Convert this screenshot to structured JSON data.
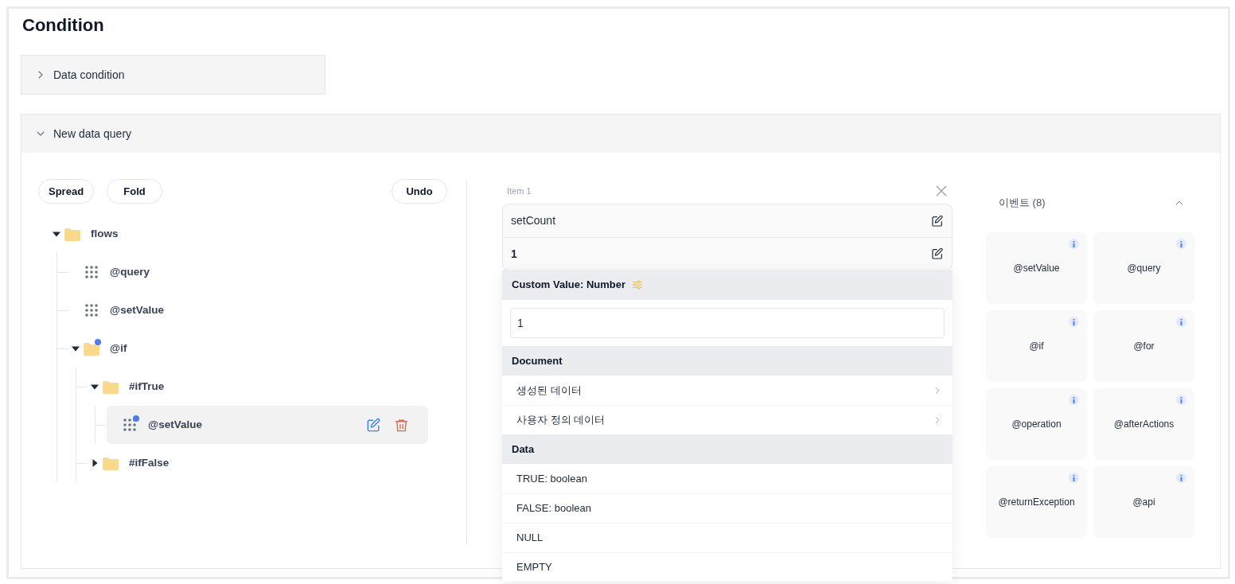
{
  "title": "Condition",
  "accordions": [
    {
      "label": "Data condition",
      "expanded": false
    },
    {
      "label": "New data query",
      "expanded": true
    }
  ],
  "toolbar": {
    "left_buttons": [
      "Spread",
      "Fold"
    ],
    "right_button": "Undo"
  },
  "tree": [
    {
      "label": "flows",
      "kind": "folder",
      "expanded": true,
      "modified": false,
      "selected": false,
      "children": [
        {
          "label": "@query",
          "kind": "node",
          "modified": false,
          "selected": false
        },
        {
          "label": "@setValue",
          "kind": "node",
          "modified": false,
          "selected": false
        },
        {
          "label": "@if",
          "kind": "folder",
          "expanded": true,
          "modified": true,
          "selected": false,
          "children": [
            {
              "label": "#ifTrue",
              "kind": "folder",
              "expanded": true,
              "modified": false,
              "selected": false,
              "children": [
                {
                  "label": "@setValue",
                  "kind": "node",
                  "modified": true,
                  "selected": true
                }
              ]
            },
            {
              "label": "#ifFalse",
              "kind": "folder",
              "expanded": false,
              "modified": false,
              "selected": false
            }
          ]
        }
      ]
    }
  ],
  "item_panel": {
    "label": "Item 1",
    "fields": [
      {
        "value": "setCount",
        "bold": false
      },
      {
        "value": "1",
        "bold": true
      }
    ],
    "dropdown": {
      "header": "Custom Value: Number",
      "input_value": "1",
      "sections": [
        {
          "title": "Document",
          "items": [
            {
              "label": "생성된 데이터",
              "has_submenu": true
            },
            {
              "label": "사용자 정의 데이터",
              "has_submenu": true
            }
          ]
        },
        {
          "title": "Data",
          "items": [
            {
              "label": "TRUE: boolean",
              "has_submenu": false
            },
            {
              "label": "FALSE: boolean",
              "has_submenu": false
            },
            {
              "label": "NULL",
              "has_submenu": false
            },
            {
              "label": "EMPTY",
              "has_submenu": false
            }
          ]
        }
      ]
    }
  },
  "events": {
    "title": "이벤트 (8)",
    "expanded": true,
    "items": [
      "@setValue",
      "@query",
      "@if",
      "@for",
      "@operation",
      "@afterActions",
      "@returnException",
      "@api"
    ]
  }
}
